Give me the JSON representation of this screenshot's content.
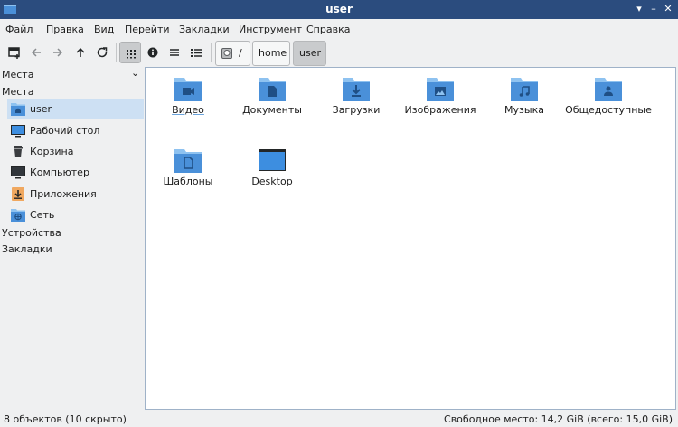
{
  "window": {
    "title": "user"
  },
  "menu": [
    "Файл",
    "Правка",
    "Вид",
    "Перейти",
    "Закладки",
    "Инструмент",
    "Справка"
  ],
  "toolbar": {
    "breadcrumbs": [
      "/",
      "home",
      "user"
    ]
  },
  "sidebar": {
    "dropdown_label": "Места",
    "sections": {
      "places": "Места",
      "devices": "Устройства",
      "bookmarks": "Закладки"
    },
    "items": [
      {
        "label": "user",
        "icon": "home-folder-icon"
      },
      {
        "label": "Рабочий стол",
        "icon": "desktop-icon"
      },
      {
        "label": "Корзина",
        "icon": "trash-icon"
      },
      {
        "label": "Компьютер",
        "icon": "computer-icon"
      },
      {
        "label": "Приложения",
        "icon": "applications-icon"
      },
      {
        "label": "Сеть",
        "icon": "network-icon"
      }
    ]
  },
  "files": [
    {
      "name": "Видео",
      "icon": "video-folder-icon"
    },
    {
      "name": "Документы",
      "icon": "documents-folder-icon"
    },
    {
      "name": "Загрузки",
      "icon": "downloads-folder-icon"
    },
    {
      "name": "Изображения",
      "icon": "pictures-folder-icon"
    },
    {
      "name": "Музыка",
      "icon": "music-folder-icon"
    },
    {
      "name": "Общедоступные",
      "icon": "public-folder-icon"
    },
    {
      "name": "Шаблоны",
      "icon": "templates-folder-icon"
    },
    {
      "name": "Desktop",
      "icon": "desktop-folder-icon"
    }
  ],
  "status": {
    "left": "8 объектов (10 скрыто)",
    "right": "Свободное место: 14,2 GiB (всего: 15,0 GiB)"
  },
  "colors": {
    "titlebar": "#2b4c7e",
    "folder": "#4a90d9",
    "selection": "#cde0f3"
  }
}
